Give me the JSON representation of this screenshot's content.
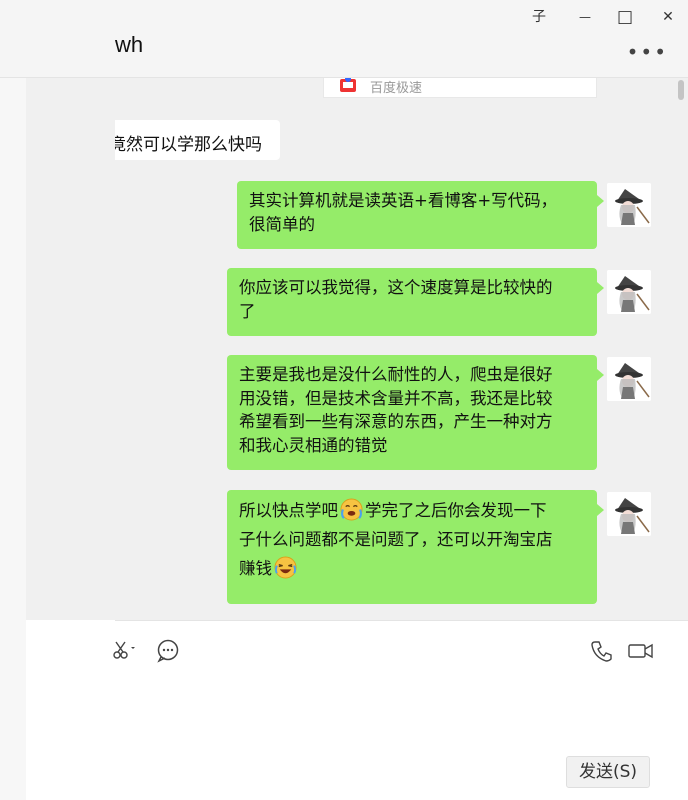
{
  "header": {
    "title": "wh",
    "pin_glyph": "子",
    "minimize_glyph": "—",
    "maximize_glyph": "□",
    "close_glyph": "✕",
    "more_glyph": "•••"
  },
  "chat": {
    "link_card_label": "百度极速",
    "received_message": "竟然可以学那么快吗",
    "sent_messages": [
      {
        "line1": "其实计算机就是读英语+看博客+写代码，",
        "line2": "很简单的"
      },
      {
        "line1": "你应该可以我觉得，这个速度算是比较快的",
        "line2": "了"
      },
      {
        "line1": "主要是我也是没什么耐性的人，爬虫是很好",
        "line2": "用没错，但是技术含量并不高，我还是比较",
        "line3": "希望看到一些有深意的东西，产生一种对方",
        "line4": "和我心灵相通的错觉"
      },
      {
        "part1": "所以快点学吧",
        "part2": "学完了之后你会发现一下",
        "line2": "子什么问题都不是问题了，还可以开淘宝店",
        "line3": "赚钱"
      }
    ]
  },
  "input": {
    "send_label": "发送(S)"
  },
  "colors": {
    "bubble_sent": "#95ec69",
    "bubble_received": "#ffffff",
    "chat_bg": "#f0f0f0"
  },
  "icons": [
    "pin-icon",
    "minimize-icon",
    "maximize-icon",
    "close-icon",
    "more-icon",
    "baidu-icon",
    "avatar-witch",
    "crying-emoji",
    "laughing-emoji",
    "scissors-icon",
    "chat-bubble-icon",
    "phone-icon",
    "video-icon"
  ]
}
